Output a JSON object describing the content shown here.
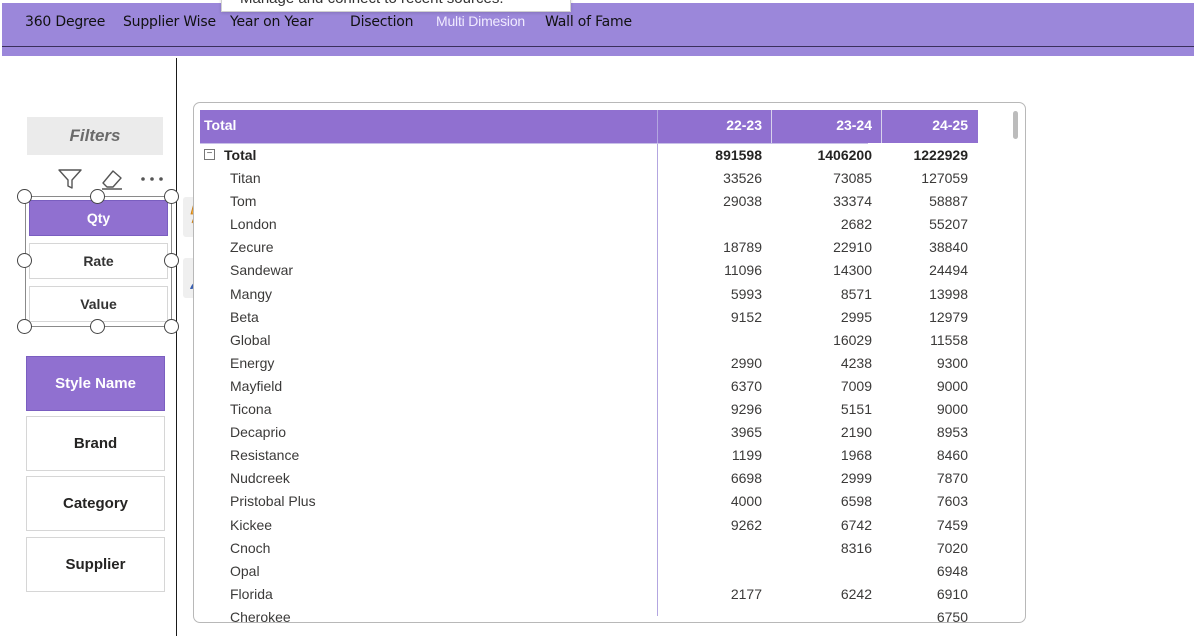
{
  "nav": {
    "items": [
      "360 Degree",
      "Supplier Wise",
      "Year on Year",
      "Disection",
      "Multi Dimesion",
      "Wall of Fame"
    ],
    "active_index": 4,
    "tooltip": "Manage and connect to recent sources."
  },
  "filters": {
    "title": "Filters",
    "measure_options": [
      "Qty",
      "Rate",
      "Value"
    ],
    "measure_selected": "Qty",
    "dimension_options": [
      "Style Name",
      "Brand",
      "Category",
      "Supplier"
    ],
    "dimension_selected": "Style Name",
    "icons": [
      "filter-icon",
      "eraser-icon",
      "more-options-icon"
    ]
  },
  "side_tools": [
    "smart-narrative-icon",
    "format-paintbrush-icon"
  ],
  "matrix": {
    "header": {
      "row_label": "Total",
      "columns": [
        "22-23",
        "23-24",
        "24-25"
      ]
    },
    "total_row": {
      "label": "Total",
      "collapse_symbol": "−",
      "values": [
        "891598",
        "1406200",
        "1222929"
      ]
    },
    "rows": [
      {
        "label": "Titan",
        "values": [
          "33526",
          "73085",
          "127059"
        ]
      },
      {
        "label": "Tom",
        "values": [
          "29038",
          "33374",
          "58887"
        ]
      },
      {
        "label": "London",
        "values": [
          "",
          "2682",
          "55207"
        ]
      },
      {
        "label": "Zecure",
        "values": [
          "18789",
          "22910",
          "38840"
        ]
      },
      {
        "label": "Sandewar",
        "values": [
          "11096",
          "14300",
          "24494"
        ]
      },
      {
        "label": "Mangy",
        "values": [
          "5993",
          "8571",
          "13998"
        ]
      },
      {
        "label": "Beta",
        "values": [
          "9152",
          "2995",
          "12979"
        ]
      },
      {
        "label": "Global",
        "values": [
          "",
          "16029",
          "11558"
        ]
      },
      {
        "label": "Energy",
        "values": [
          "2990",
          "4238",
          "9300"
        ]
      },
      {
        "label": "Mayfield",
        "values": [
          "6370",
          "7009",
          "9000"
        ]
      },
      {
        "label": "Ticona",
        "values": [
          "9296",
          "5151",
          "9000"
        ]
      },
      {
        "label": "Decaprio",
        "values": [
          "3965",
          "2190",
          "8953"
        ]
      },
      {
        "label": "Resistance",
        "values": [
          "1199",
          "1968",
          "8460"
        ]
      },
      {
        "label": "Nudcreek",
        "values": [
          "6698",
          "2999",
          "7870"
        ]
      },
      {
        "label": "Pristobal Plus",
        "values": [
          "4000",
          "6598",
          "7603"
        ]
      },
      {
        "label": "Kickee",
        "values": [
          "9262",
          "6742",
          "7459"
        ]
      },
      {
        "label": "Cnoch",
        "values": [
          "",
          "8316",
          "7020"
        ]
      },
      {
        "label": "Opal",
        "values": [
          "",
          "",
          "6948"
        ]
      },
      {
        "label": "Florida",
        "values": [
          "2177",
          "6242",
          "6910"
        ]
      },
      {
        "label": "Cherokee",
        "values": [
          "",
          "",
          "6750"
        ]
      }
    ]
  },
  "colors": {
    "accent": "#9070d0",
    "nav_bg": "#9b87da"
  }
}
